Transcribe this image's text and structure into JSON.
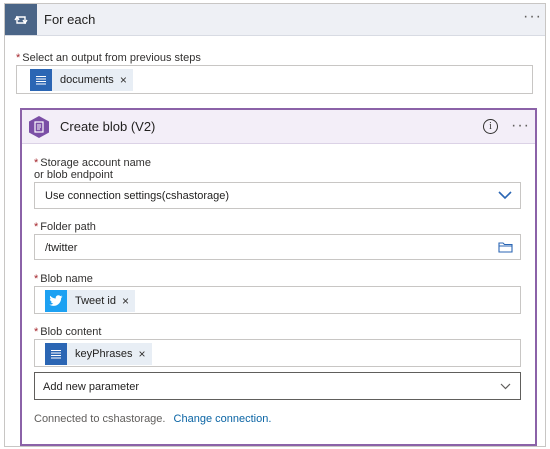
{
  "foreach": {
    "title": "For each",
    "more_icon": "ellipsis-icon",
    "output_label": "Select an output from previous steps",
    "output_token": {
      "label": "documents",
      "icon": "expression-list-icon",
      "remove": "×"
    }
  },
  "blob": {
    "title": "Create blob (V2)",
    "info_icon": "info-icon",
    "more_icon": "ellipsis-icon",
    "storage": {
      "label_line1": "Storage account name",
      "label_line2": "or blob endpoint",
      "value": "Use connection settings(cshastorage)"
    },
    "folder": {
      "label": "Folder path",
      "value": "/twitter"
    },
    "blob_name": {
      "label": "Blob name",
      "token": {
        "label": "Tweet id",
        "icon": "twitter-icon",
        "remove": "×"
      }
    },
    "blob_content": {
      "label": "Blob content",
      "token": {
        "label": "keyPhrases",
        "icon": "expression-list-icon",
        "remove": "×"
      }
    },
    "add_param": "Add new parameter",
    "connected_text": "Connected to cshastorage.",
    "change_link": "Change connection.",
    "required_mark": "*"
  },
  "colors": {
    "foreach_icon_bg": "#4a6587",
    "blob_border": "#8b62a8",
    "token_icon_bg": "#2b66b4",
    "twitter_bg": "#1da1f2",
    "link": "#0a64a4"
  }
}
